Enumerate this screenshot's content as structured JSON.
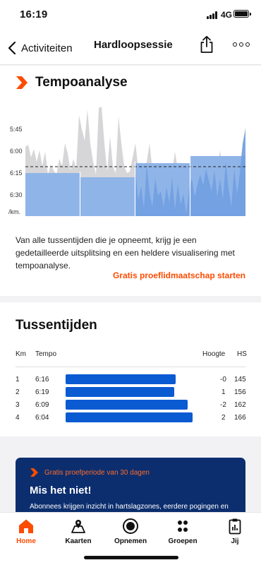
{
  "status": {
    "time": "16:19",
    "network": "4G"
  },
  "nav": {
    "back_label": "Activiteiten",
    "title": "Hardloopsessie"
  },
  "tempo": {
    "title": "Tempoanalyse",
    "description": "Van alle tussentijden die je opneemt, krijg je een gedetailleerde uitsplitsing en een heldere visualisering met tempoanalyse.",
    "trial_link": "Gratis proeflidmaatschap starten",
    "chart_data": {
      "type": "area",
      "y_ticks": [
        "5:45",
        "6:00",
        "6:15",
        "6:30"
      ],
      "y_unit": "/km.",
      "y_axis": "pace min/km, inverted",
      "splits_km": [
        1,
        2,
        3,
        4
      ],
      "split_pace": [
        "6:16",
        "6:19",
        "6:09",
        "6:04"
      ],
      "average_line": "6:13",
      "colors": {
        "pace_area": "#d4d4d6",
        "split_bars": "#8fb4e8",
        "average_line": "#222222"
      }
    }
  },
  "splits": {
    "title": "Tussentijden",
    "headers": {
      "km": "Km",
      "tempo": "Tempo",
      "elev": "Hoogte",
      "hr": "HS"
    },
    "rows": [
      {
        "km": "1",
        "pace": "6:16",
        "elev": "-0",
        "hr": "145",
        "bar_fraction": 0.84
      },
      {
        "km": "2",
        "pace": "6:19",
        "elev": "1",
        "hr": "156",
        "bar_fraction": 0.83
      },
      {
        "km": "3",
        "pace": "6:09",
        "elev": "-2",
        "hr": "162",
        "bar_fraction": 0.93
      },
      {
        "km": "4",
        "pace": "6:04",
        "elev": "2",
        "hr": "166",
        "bar_fraction": 0.97
      }
    ],
    "bar_color": "#0a5ad2"
  },
  "promo": {
    "eyebrow": "Gratis proefperiode van 30 dagen",
    "title": "Mis het niet!",
    "body": "Abonnees krijgen inzicht in hartslagzones, eerdere pogingen en"
  },
  "tabs": [
    {
      "label": "Home",
      "icon": "home-icon",
      "active": true
    },
    {
      "label": "Kaarten",
      "icon": "map-icon",
      "active": false
    },
    {
      "label": "Opnemen",
      "icon": "record-icon",
      "active": false
    },
    {
      "label": "Groepen",
      "icon": "groups-icon",
      "active": false
    },
    {
      "label": "Jij",
      "icon": "profile-clipboard-icon",
      "active": false
    }
  ],
  "brand": {
    "accent": "#fc4c02",
    "promo_bg": "#0c2e6e"
  }
}
